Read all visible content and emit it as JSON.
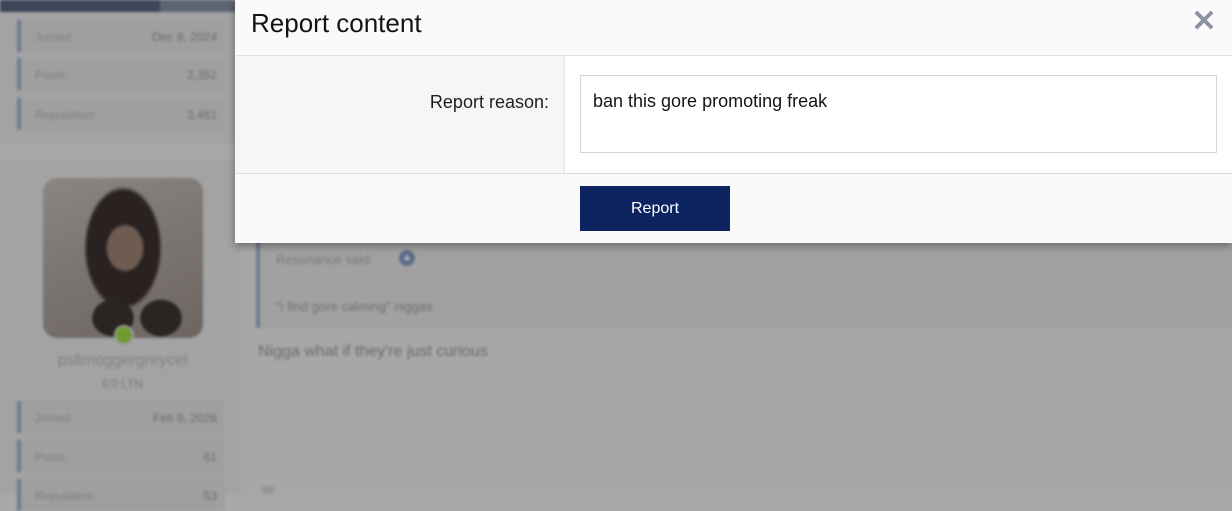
{
  "background": {
    "user1": {
      "stats": [
        {
          "label": "Joined:",
          "value": "Dec 8, 2024"
        },
        {
          "label": "Posts:",
          "value": "2,352"
        },
        {
          "label": "Reputation:",
          "value": "3,461"
        }
      ]
    },
    "user2": {
      "username": "psllmoggergreycel",
      "user_title": "6'0 LTN",
      "stats": [
        {
          "label": "Joined:",
          "value": "Feb 6, 2026"
        },
        {
          "label": "Posts:",
          "value": "61"
        },
        {
          "label": "Reputation:",
          "value": "53"
        }
      ]
    },
    "quote": {
      "author": "Resonance said:",
      "arrow_icon": "up-arrow-icon",
      "text": "\"i find gore calming\" niggas"
    },
    "post_text": "Nigga what if they're just curious"
  },
  "modal": {
    "title": "Report content",
    "close_icon": "close-icon",
    "reason_label": "Report reason:",
    "reason_value": "ban this gore promoting freak",
    "submit_label": "Report"
  },
  "colors": {
    "accent": "#0d2461",
    "overlay": "#a9a9a9",
    "modal_bg": "#ffffff",
    "header_bg": "#fafafa"
  }
}
